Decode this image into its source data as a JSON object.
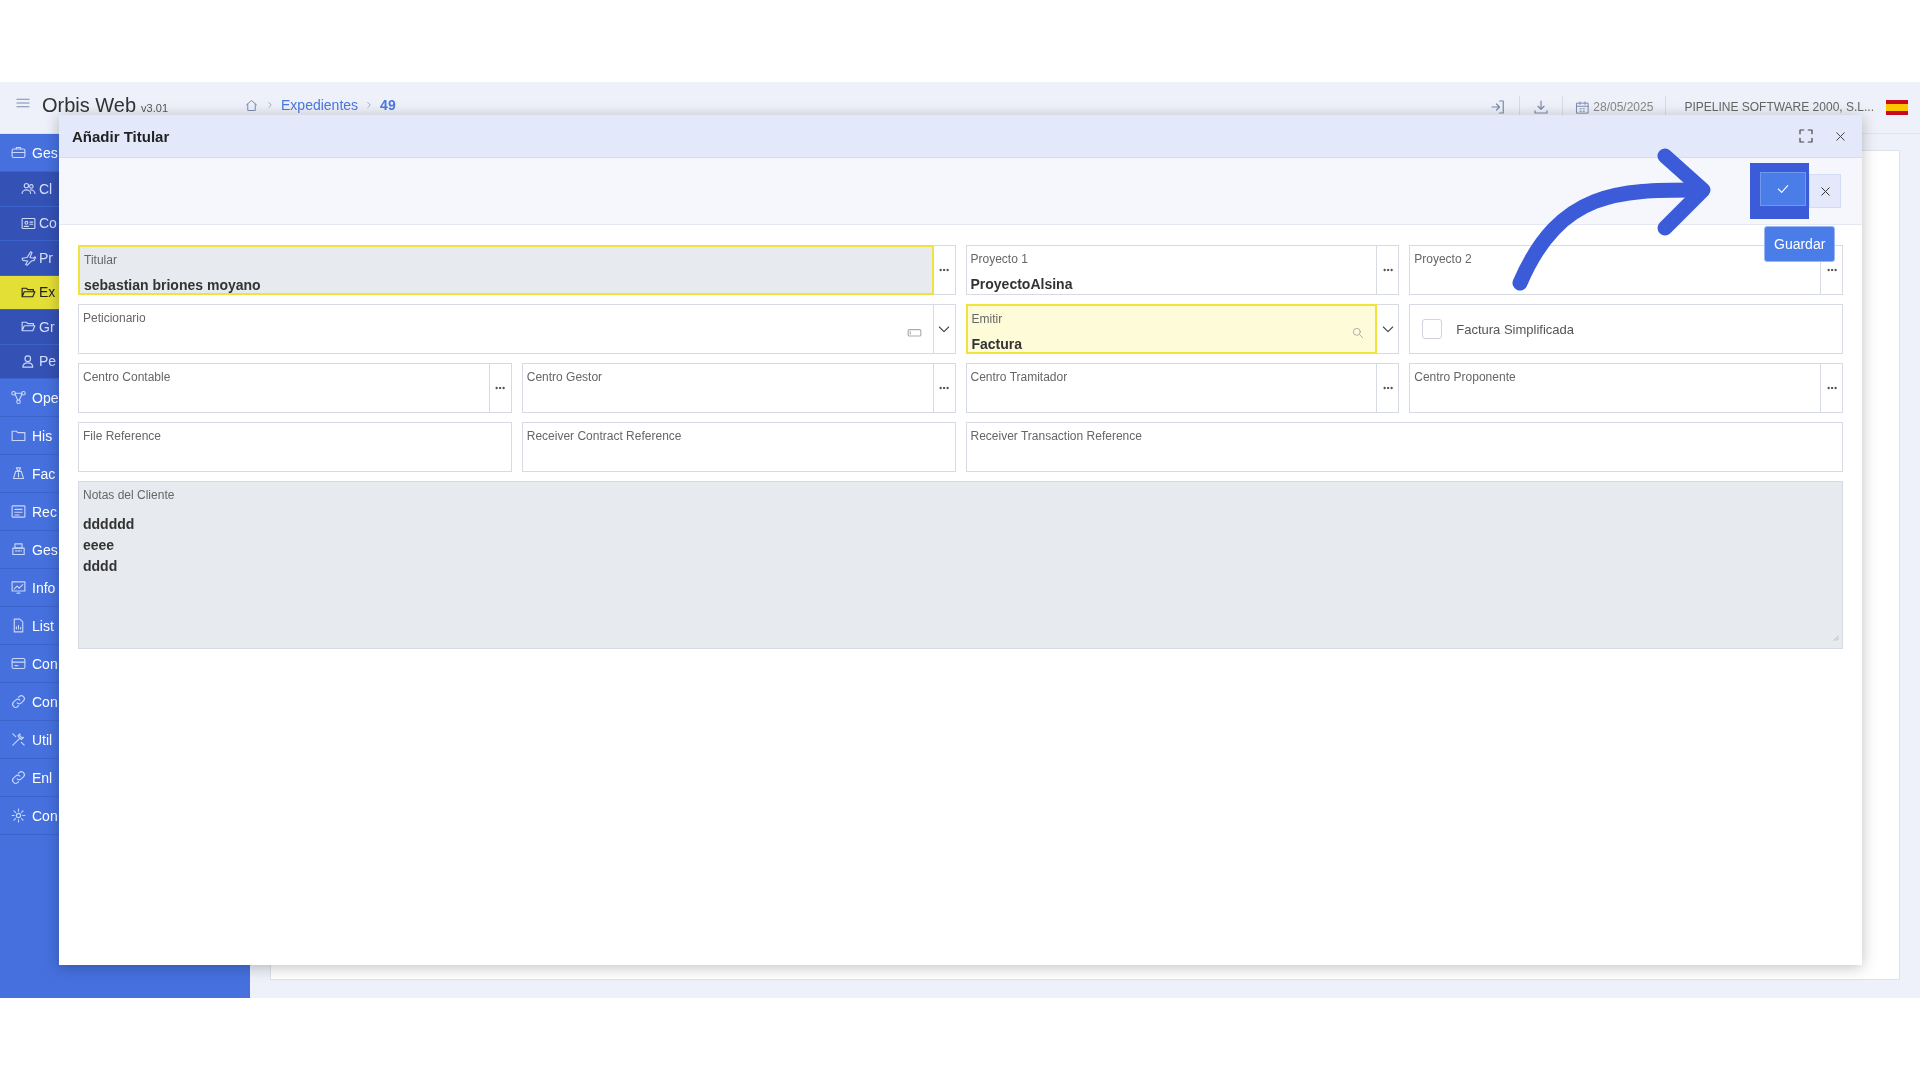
{
  "topbar": {
    "app_name": "Orbis Web",
    "version": "v3.01",
    "breadcrumbs": [
      {
        "label": "Expedientes",
        "current": false
      },
      {
        "label": "49",
        "current": true
      }
    ],
    "date": "28/05/2025",
    "company": "PIPELINE SOFTWARE 2000, S.L..."
  },
  "sidebar": {
    "items": [
      {
        "label": "Ges",
        "selected": false,
        "expanded": true,
        "children": [
          {
            "label": "Cl",
            "selected": false
          },
          {
            "label": "Co",
            "selected": false
          },
          {
            "label": "Pr",
            "selected": false
          },
          {
            "label": "Ex",
            "selected": true
          },
          {
            "label": "Gr",
            "selected": false
          },
          {
            "label": "Pe",
            "selected": false
          }
        ]
      },
      {
        "label": "Ope",
        "selected": false,
        "expanded": false
      },
      {
        "label": "His",
        "selected": false,
        "expanded": false
      },
      {
        "label": "Fac",
        "selected": false,
        "expanded": false
      },
      {
        "label": "Rec",
        "selected": false,
        "expanded": false
      },
      {
        "label": "Ges",
        "selected": false,
        "expanded": false
      },
      {
        "label": "Info",
        "selected": false,
        "expanded": false
      },
      {
        "label": "List",
        "selected": false,
        "expanded": false
      },
      {
        "label": "Con",
        "selected": false,
        "expanded": false
      },
      {
        "label": "Con",
        "selected": false,
        "expanded": false
      },
      {
        "label": "Util",
        "selected": false,
        "expanded": false
      },
      {
        "label": "Enl",
        "selected": false,
        "expanded": false
      },
      {
        "label": "Con",
        "selected": false,
        "expanded": false
      }
    ]
  },
  "dialog": {
    "title": "Añadir Titular",
    "toolbar": {
      "save": {
        "tooltip": "Guardar",
        "highlighted": true
      }
    },
    "annotations": [
      {
        "kind": "arrow"
      }
    ],
    "fields": [
      {
        "kind": "lookup",
        "label": "Titular",
        "value": "sebastian briones moyano",
        "highlighted": true,
        "readonly": true
      },
      {
        "kind": "lookup",
        "label": "Proyecto 1",
        "value": "ProyectoAlsina",
        "highlighted": false,
        "readonly": false
      },
      {
        "kind": "lookup",
        "label": "Proyecto 2",
        "highlighted": false,
        "readonly": false
      },
      {
        "kind": "dropdown",
        "label": "Peticionario",
        "highlighted": false,
        "readonly": false
      },
      {
        "kind": "search-dropdown",
        "label": "Emitir",
        "value": "Factura",
        "highlighted": true,
        "readonly": false
      },
      {
        "kind": "checkbox",
        "label": "Factura Simplificada",
        "checked": false
      },
      {
        "kind": "lookup",
        "label": "Centro Contable",
        "highlighted": false,
        "readonly": false
      },
      {
        "kind": "lookup",
        "label": "Centro Gestor",
        "highlighted": false,
        "readonly": false
      },
      {
        "kind": "lookup",
        "label": "Centro Tramitador",
        "highlighted": false,
        "readonly": false
      },
      {
        "kind": "lookup",
        "label": "Centro Proponente",
        "highlighted": false,
        "readonly": false
      },
      {
        "kind": "text",
        "label": "File Reference",
        "highlighted": false,
        "readonly": false
      },
      {
        "kind": "text",
        "label": "Receiver Contract Reference",
        "highlighted": false,
        "readonly": false
      },
      {
        "kind": "text",
        "label": "Receiver Transaction Reference",
        "highlighted": false,
        "readonly": false
      },
      {
        "kind": "textarea",
        "label": "Notas del Cliente",
        "lines": [
          "dddddd",
          "eeee",
          "dddd"
        ],
        "highlighted": false,
        "readonly": true
      }
    ]
  }
}
